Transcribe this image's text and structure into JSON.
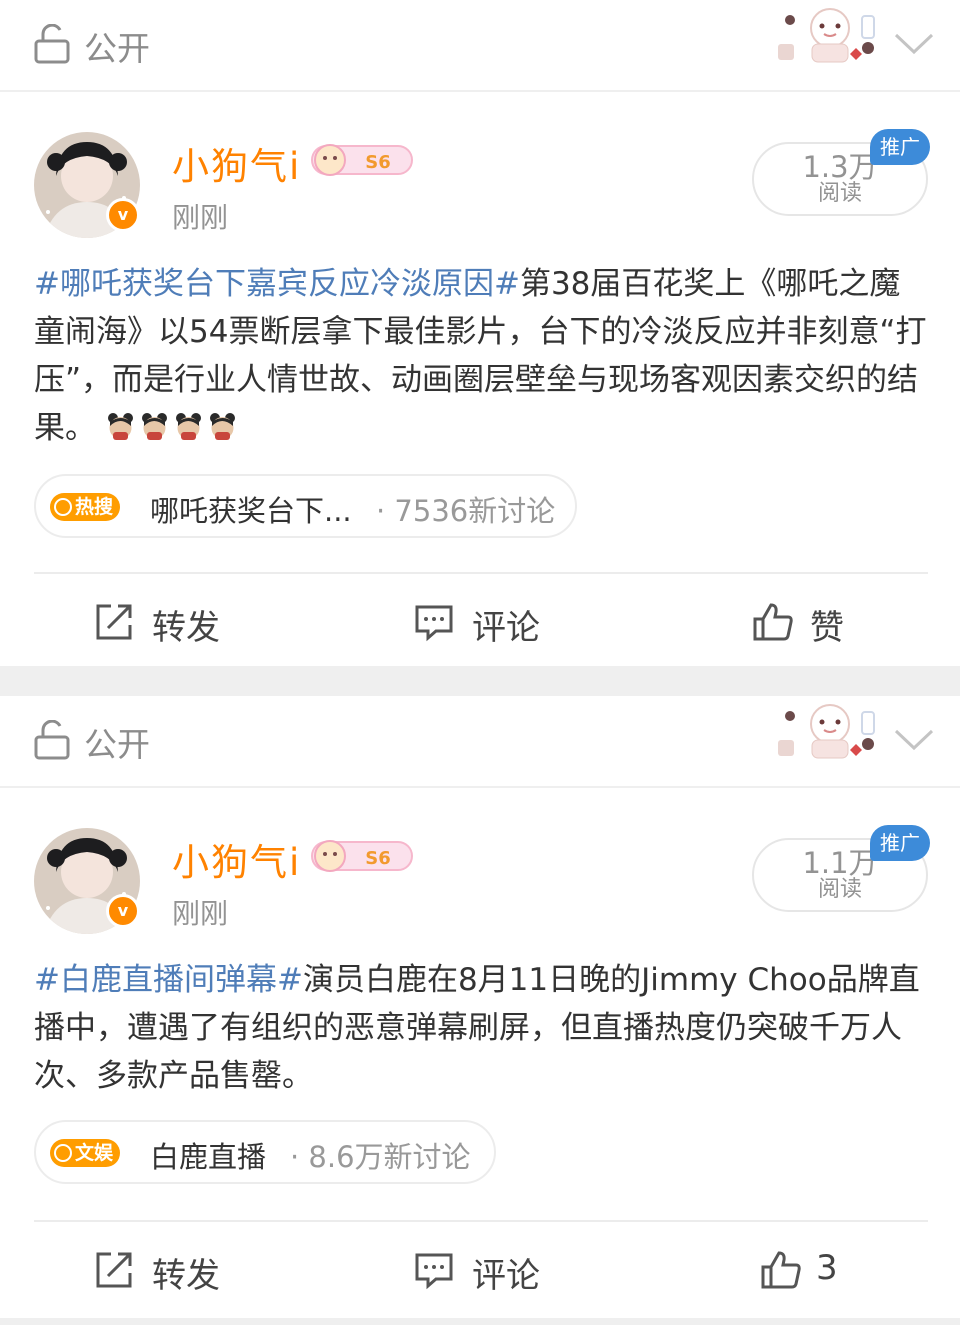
{
  "colors": {
    "accent_orange": "#ff8200",
    "hashtag_blue": "#4f7db8",
    "ad_blue": "#3d8bd9",
    "muted_gray": "#939393"
  },
  "privacy_bars": [
    {
      "icon": "unlock-icon",
      "label": "公开"
    },
    {
      "icon": "unlock-icon",
      "label": "公开"
    }
  ],
  "posts": [
    {
      "username": "小狗气i",
      "level": "S6",
      "time": "刚刚",
      "reads": {
        "count": "1.3万",
        "unit": "阅读"
      },
      "ad_label": "推广",
      "hashtag": "#哪吒获奖台下嘉宾反应冷淡原因#",
      "body": "第38届百花奖上《哪吒之魔童闹海》以54票断层拿下最佳影片，台下的冷淡反应并非刻意“打压”，而是行业人情世故、动画圈层壁垒与现场客观因素交织的结果。",
      "emoji_count": 4,
      "topic": {
        "badge": "热搜",
        "title": "哪吒获奖台下...",
        "discussion": " · 7536新讨论"
      },
      "actions": {
        "repost": "转发",
        "comment": "评论",
        "like": "赞"
      }
    },
    {
      "username": "小狗气i",
      "level": "S6",
      "time": "刚刚",
      "reads": {
        "count": "1.1万",
        "unit": "阅读"
      },
      "ad_label": "推广",
      "hashtag": "#白鹿直播间弹幕#",
      "body": "演员白鹿在8月11日晚的Jimmy Choo品牌直播中，遭遇了有组织的恶意弹幕刷屏，但直播热度仍突破千万人次、多款产品售罄。",
      "emoji_count": 0,
      "topic": {
        "badge": "文娱",
        "title": "白鹿直播",
        "discussion": " · 8.6万新讨论"
      },
      "actions": {
        "repost": "转发",
        "comment": "评论",
        "like": "3"
      }
    }
  ]
}
